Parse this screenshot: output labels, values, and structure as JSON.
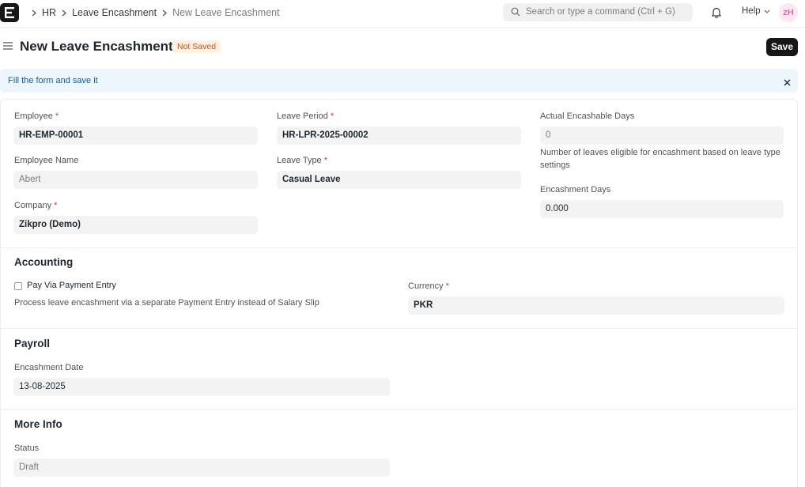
{
  "navbar": {
    "breadcrumbs": [
      "HR",
      "Leave Encashment",
      "New Leave Encashment"
    ],
    "search_placeholder": "Search or type a command (Ctrl + G)",
    "help_label": "Help",
    "avatar_initials": "zH"
  },
  "page": {
    "title": "New Leave Encashment",
    "status_indicator": "Not Saved",
    "save_label": "Save"
  },
  "alert": {
    "message": "Fill the form and save it"
  },
  "form": {
    "employee": {
      "label": "Employee",
      "value": "HR-EMP-00001"
    },
    "employee_name": {
      "label": "Employee Name",
      "value": "Abert"
    },
    "company": {
      "label": "Company",
      "value": "Zikpro (Demo)"
    },
    "leave_period": {
      "label": "Leave Period",
      "value": "HR-LPR-2025-00002"
    },
    "leave_type": {
      "label": "Leave Type",
      "value": "Casual Leave"
    },
    "actual_encashable_days": {
      "label": "Actual Encashable Days",
      "value": "0",
      "description_line1": "Number of leaves eligible for encashment based on leave type",
      "description_line2": "settings"
    },
    "encashment_days": {
      "label": "Encashment Days",
      "value": "0.000"
    },
    "accounting": {
      "title": "Accounting",
      "pay_via_payment_entry_label": "Pay Via Payment Entry",
      "pay_via_payment_entry_checked": false,
      "pay_via_payment_entry_description": "Process leave encashment via a separate Payment Entry instead of Salary Slip",
      "currency": {
        "label": "Currency",
        "value": "PKR"
      }
    },
    "payroll": {
      "title": "Payroll",
      "encashment_date": {
        "label": "Encashment Date",
        "value": "13-08-2025"
      }
    },
    "more_info": {
      "title": "More Info",
      "status": {
        "label": "Status",
        "value": "Draft"
      }
    }
  },
  "colors": {
    "primary_button": "#171717",
    "indicator_bg": "#fff0e2",
    "indicator_text": "#c4531f",
    "alert_bg": "#edf6fd",
    "alert_text": "#0f5d97",
    "required_marker": "#e03636"
  },
  "icons": [
    "app-logo",
    "breadcrumb-chevron-icon",
    "search-icon",
    "bell-icon",
    "chevron-down-icon",
    "hamburger-icon",
    "close-icon"
  ]
}
